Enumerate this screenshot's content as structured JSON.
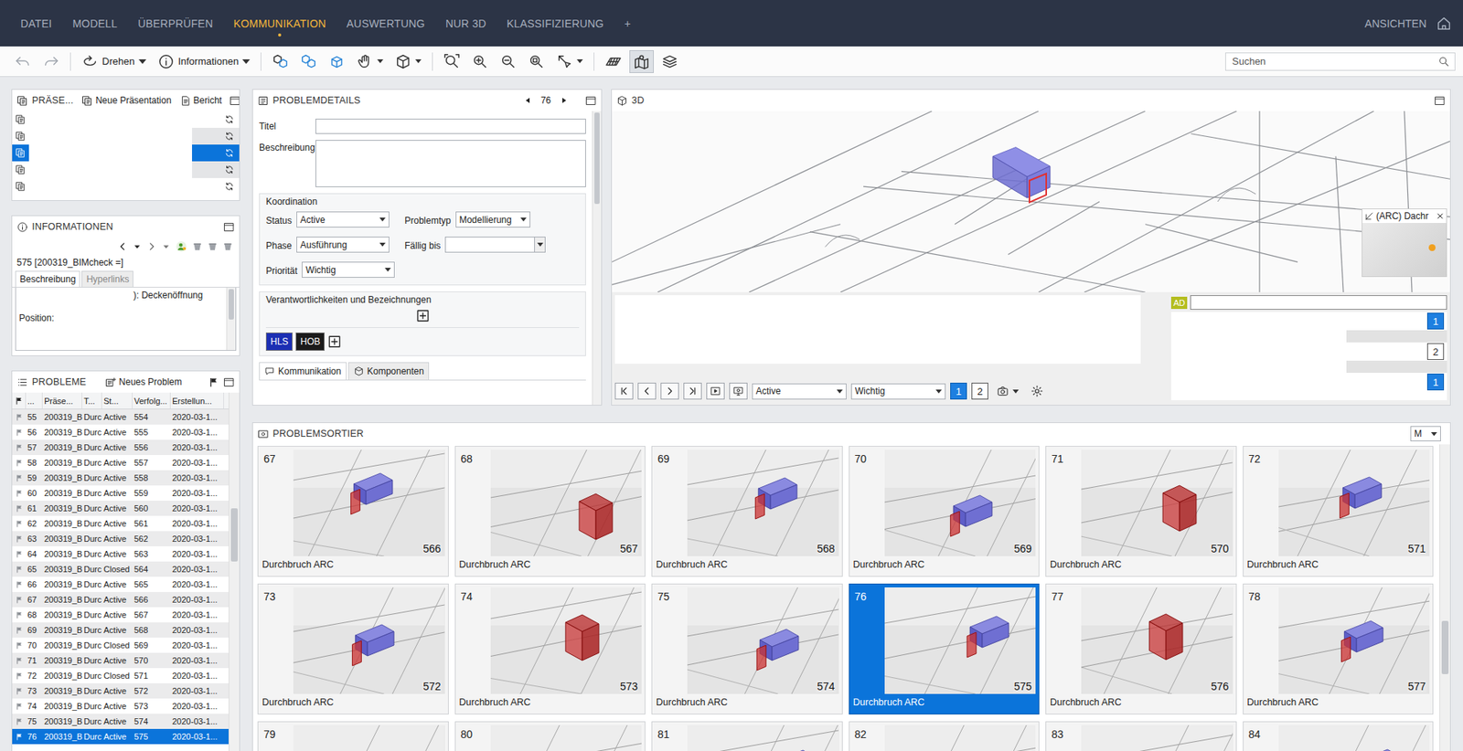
{
  "menu": {
    "items": [
      {
        "label": "DATEI",
        "selected": false
      },
      {
        "label": "MODELL",
        "selected": false
      },
      {
        "label": "ÜBERPRÜFEN",
        "selected": false
      },
      {
        "label": "KOMMUNIKATION",
        "selected": true
      },
      {
        "label": "AUSWERTUNG",
        "selected": false
      },
      {
        "label": "NUR 3D",
        "selected": false
      },
      {
        "label": "KLASSIFIZIERUNG",
        "selected": false
      },
      {
        "label": "+",
        "selected": false
      }
    ],
    "views": "ANSICHTEN"
  },
  "toolbar": {
    "rotate": "Drehen",
    "info": "Informationen",
    "mapView": {
      "pressed": true
    },
    "search": {
      "placeholder": "Suchen"
    }
  },
  "presentations": {
    "title": "PRÄSE...",
    "new": "Neue Präsentation",
    "report": "Bericht",
    "rows": [
      {
        "selected": false,
        "shaded": false
      },
      {
        "selected": false,
        "shaded": true
      },
      {
        "selected": true,
        "shaded": false
      },
      {
        "selected": false,
        "shaded": true
      },
      {
        "selected": false,
        "shaded": false
      }
    ]
  },
  "info": {
    "title": "INFORMATIONEN",
    "issue": "575 [200319_BIMcheck =]",
    "tabs": [
      {
        "label": "Beschreibung",
        "selected": true
      },
      {
        "label": "Hyperlinks",
        "selected": false
      }
    ],
    "text": "): Deckenöffnung",
    "position": "Position:"
  },
  "problems": {
    "title": "PROBLEME",
    "new": "Neues Problem",
    "columns": [
      "...",
      "Präse...",
      "T...",
      "St...",
      "Verfolg...",
      "Erstellun..."
    ],
    "rows": [
      {
        "cells": [
          "55",
          "200319_B",
          "Durc",
          "Active",
          "554",
          "2020-03-1..."
        ],
        "selected": false
      },
      {
        "cells": [
          "56",
          "200319_B",
          "Durc",
          "Active",
          "555",
          "2020-03-1..."
        ],
        "selected": false
      },
      {
        "cells": [
          "57",
          "200319_B",
          "Durc",
          "Active",
          "556",
          "2020-03-1..."
        ],
        "selected": false
      },
      {
        "cells": [
          "58",
          "200319_B",
          "Durc",
          "Active",
          "557",
          "2020-03-1..."
        ],
        "selected": false
      },
      {
        "cells": [
          "59",
          "200319_B",
          "Durc",
          "Active",
          "558",
          "2020-03-1..."
        ],
        "selected": false
      },
      {
        "cells": [
          "60",
          "200319_B",
          "Durc",
          "Active",
          "559",
          "2020-03-1..."
        ],
        "selected": false
      },
      {
        "cells": [
          "61",
          "200319_B",
          "Durc",
          "Active",
          "560",
          "2020-03-1..."
        ],
        "selected": false
      },
      {
        "cells": [
          "62",
          "200319_B",
          "Durc",
          "Active",
          "561",
          "2020-03-1..."
        ],
        "selected": false
      },
      {
        "cells": [
          "63",
          "200319_B",
          "Durc",
          "Active",
          "562",
          "2020-03-1..."
        ],
        "selected": false
      },
      {
        "cells": [
          "64",
          "200319_B",
          "Durc",
          "Active",
          "563",
          "2020-03-1..."
        ],
        "selected": false
      },
      {
        "cells": [
          "65",
          "200319_B",
          "Durc",
          "Closed",
          "564",
          "2020-03-1..."
        ],
        "selected": false
      },
      {
        "cells": [
          "66",
          "200319_B",
          "Durc",
          "Active",
          "565",
          "2020-03-1..."
        ],
        "selected": false
      },
      {
        "cells": [
          "67",
          "200319_B",
          "Durc",
          "Active",
          "566",
          "2020-03-1..."
        ],
        "selected": false
      },
      {
        "cells": [
          "68",
          "200319_B",
          "Durc",
          "Active",
          "567",
          "2020-03-1..."
        ],
        "selected": false
      },
      {
        "cells": [
          "69",
          "200319_B",
          "Durc",
          "Active",
          "568",
          "2020-03-1..."
        ],
        "selected": false
      },
      {
        "cells": [
          "70",
          "200319_B",
          "Durc",
          "Closed",
          "569",
          "2020-03-1..."
        ],
        "selected": false
      },
      {
        "cells": [
          "71",
          "200319_B",
          "Durc",
          "Active",
          "570",
          "2020-03-1..."
        ],
        "selected": false
      },
      {
        "cells": [
          "72",
          "200319_B",
          "Durc",
          "Closed",
          "571",
          "2020-03-1..."
        ],
        "selected": false
      },
      {
        "cells": [
          "73",
          "200319_B",
          "Durc",
          "Active",
          "572",
          "2020-03-1..."
        ],
        "selected": false
      },
      {
        "cells": [
          "74",
          "200319_B",
          "Durc",
          "Active",
          "573",
          "2020-03-1..."
        ],
        "selected": false
      },
      {
        "cells": [
          "75",
          "200319_B",
          "Durc",
          "Active",
          "574",
          "2020-03-1..."
        ],
        "selected": false
      },
      {
        "cells": [
          "76",
          "200319_B",
          "Durc",
          "Active",
          "575",
          "2020-03-1..."
        ],
        "selected": true
      }
    ]
  },
  "details": {
    "title": "PROBLEMDETAILS",
    "index": "76",
    "titleLabel": "Titel",
    "descLabel": "Beschreibung",
    "group": "Koordination",
    "fields": [
      {
        "label": "Status",
        "value": "Active",
        "kind": "select"
      },
      {
        "label": "Problemtyp",
        "value": "Modellierung",
        "kind": "select"
      },
      {
        "label": "Phase",
        "value": "Ausführung",
        "kind": "select"
      },
      {
        "label": "Fällig bis",
        "kind": "date"
      },
      {
        "label": "Priorität",
        "value": "Wichtig",
        "kind": "select"
      }
    ],
    "responsibility": "Verantwortlichkeiten und Bezeichnungen",
    "tags": [
      {
        "label": "HLS",
        "color": "#1c2fb4"
      },
      {
        "label": "HOB",
        "color": "#1b1b1b"
      }
    ],
    "tabs": [
      {
        "label": "Kommunikation",
        "selected": true
      },
      {
        "label": "Komponenten",
        "selected": false
      }
    ]
  },
  "view3d": {
    "title": "3D",
    "overlay": "(ARC) Dachr",
    "status": "Active",
    "priority": "Wichtig",
    "pages": [
      {
        "label": "1",
        "selected": true
      },
      {
        "label": "2",
        "selected": false
      }
    ],
    "author": "AD",
    "markers": [
      {
        "label": "1",
        "selected": true
      },
      {
        "label": "2",
        "selected": false
      },
      {
        "label": "1",
        "selected": true
      }
    ]
  },
  "sorter": {
    "title": "PROBLEMSORTIER",
    "size": "M",
    "cards": [
      {
        "number": "67",
        "id": "566",
        "label": "Durchbruch ARC",
        "selected": false
      },
      {
        "number": "68",
        "id": "567",
        "label": "Durchbruch ARC",
        "selected": false
      },
      {
        "number": "69",
        "id": "568",
        "label": "Durchbruch ARC",
        "selected": false
      },
      {
        "number": "70",
        "id": "569",
        "label": "Durchbruch ARC",
        "selected": false
      },
      {
        "number": "71",
        "id": "570",
        "label": "Durchbruch ARC",
        "selected": false
      },
      {
        "number": "72",
        "id": "571",
        "label": "Durchbruch ARC",
        "selected": false
      },
      {
        "number": "73",
        "id": "572",
        "label": "Durchbruch ARC",
        "selected": false
      },
      {
        "number": "74",
        "id": "573",
        "label": "Durchbruch ARC",
        "selected": false
      },
      {
        "number": "75",
        "id": "574",
        "label": "Durchbruch ARC",
        "selected": false
      },
      {
        "number": "76",
        "id": "575",
        "label": "Durchbruch ARC",
        "selected": true
      },
      {
        "number": "77",
        "id": "576",
        "label": "Durchbruch ARC",
        "selected": false
      },
      {
        "number": "78",
        "id": "577",
        "label": "Durchbruch ARC",
        "selected": false
      },
      {
        "number": "79",
        "selected": false
      },
      {
        "number": "80",
        "selected": false
      },
      {
        "number": "81",
        "selected": false
      },
      {
        "number": "82",
        "selected": false
      },
      {
        "number": "83",
        "selected": false
      },
      {
        "number": "84",
        "selected": false
      }
    ]
  }
}
